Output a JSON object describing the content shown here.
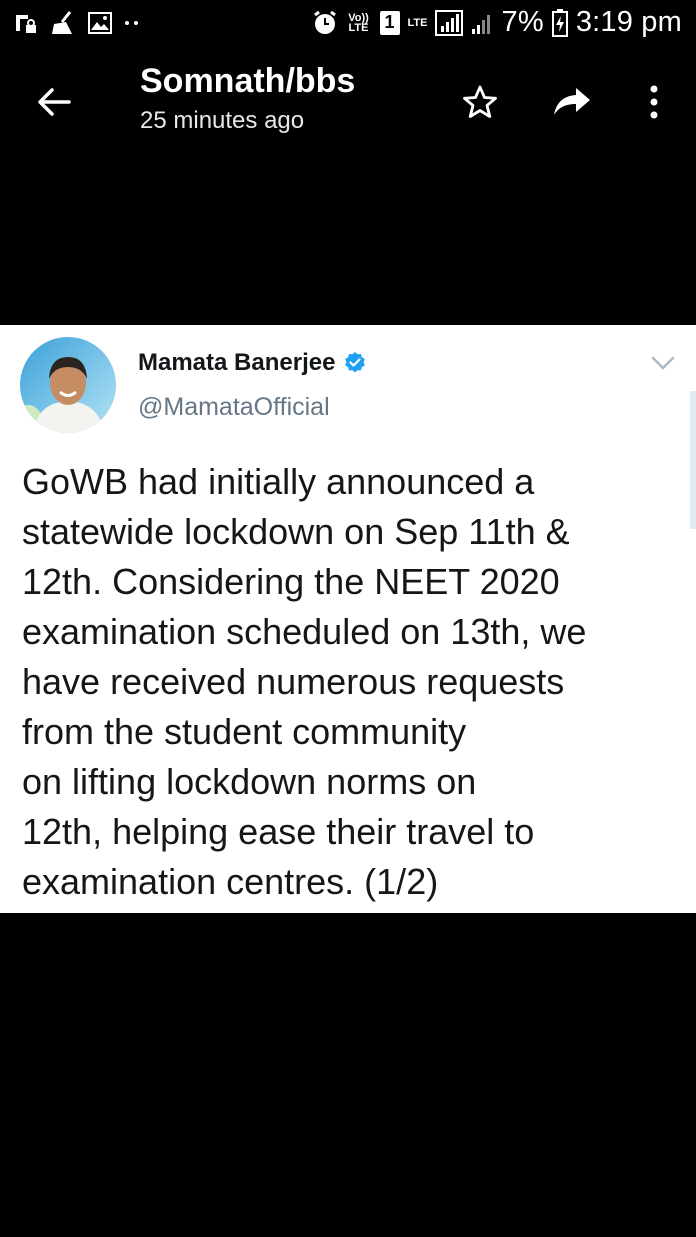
{
  "status_bar": {
    "signal_label": "Vo)) LTE",
    "sim_slot": "1",
    "network_type": "LTE",
    "battery_percent": "7%",
    "time": "3:19 pm"
  },
  "toolbar": {
    "title": "Somnath/bbs",
    "subtitle": "25 minutes ago"
  },
  "tweet": {
    "author_name": "Mamata Banerjee",
    "handle": "@MamataOfficial",
    "text_lines": [
      "GoWB had initially announced a",
      "statewide lockdown on Sep 11th &",
      "12th. Considering the NEET 2020",
      "examination scheduled on 13th, we",
      "have received numerous requests",
      "from the student community",
      "on lifting lockdown norms on",
      "12th, helping ease their travel to",
      "examination centres. (1/2)"
    ]
  },
  "colors": {
    "background": "#000000",
    "card": "#ffffff",
    "verified_blue": "#1da1f2",
    "handle_gray": "#657786"
  }
}
